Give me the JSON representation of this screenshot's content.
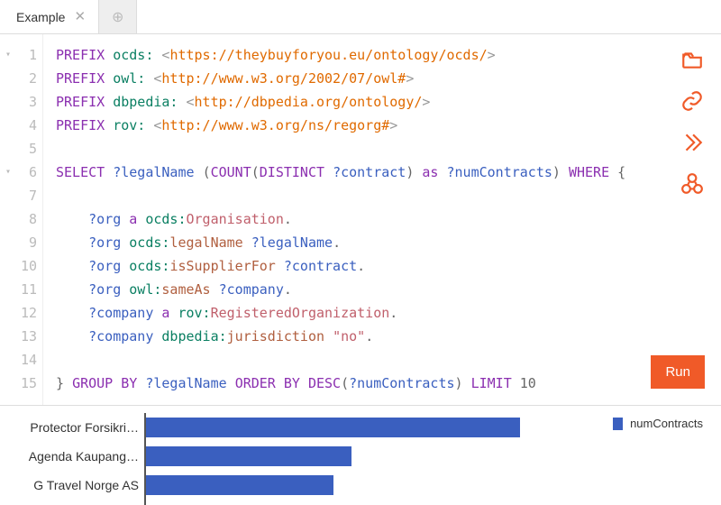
{
  "tabs": {
    "active_label": "Example"
  },
  "editor": {
    "lines": [
      [
        [
          "kw",
          "PREFIX"
        ],
        [
          "sp",
          " "
        ],
        [
          "pfx",
          "ocds:"
        ],
        [
          "sp",
          " "
        ],
        [
          "ang",
          "<"
        ],
        [
          "uri",
          "https://theybuyforyou.eu/ontology/ocds/"
        ],
        [
          "ang",
          ">"
        ]
      ],
      [
        [
          "kw",
          "PREFIX"
        ],
        [
          "sp",
          " "
        ],
        [
          "pfx",
          "owl:"
        ],
        [
          "sp",
          " "
        ],
        [
          "ang",
          "<"
        ],
        [
          "uri",
          "http://www.w3.org/2002/07/owl#"
        ],
        [
          "ang",
          ">"
        ]
      ],
      [
        [
          "kw",
          "PREFIX"
        ],
        [
          "sp",
          " "
        ],
        [
          "pfx",
          "dbpedia:"
        ],
        [
          "sp",
          " "
        ],
        [
          "ang",
          "<"
        ],
        [
          "uri",
          "http://dbpedia.org/ontology/"
        ],
        [
          "ang",
          ">"
        ]
      ],
      [
        [
          "kw",
          "PREFIX"
        ],
        [
          "sp",
          " "
        ],
        [
          "pfx",
          "rov:"
        ],
        [
          "sp",
          " "
        ],
        [
          "ang",
          "<"
        ],
        [
          "uri",
          "http://www.w3.org/ns/regorg#"
        ],
        [
          "ang",
          ">"
        ]
      ],
      [],
      [
        [
          "kw",
          "SELECT"
        ],
        [
          "sp",
          " "
        ],
        [
          "var",
          "?legalName"
        ],
        [
          "sp",
          " "
        ],
        [
          "punct",
          "("
        ],
        [
          "kw",
          "COUNT"
        ],
        [
          "punct",
          "("
        ],
        [
          "kw",
          "DISTINCT"
        ],
        [
          "sp",
          " "
        ],
        [
          "var",
          "?contract"
        ],
        [
          "punct",
          ")"
        ],
        [
          "sp",
          " "
        ],
        [
          "kw",
          "as"
        ],
        [
          "sp",
          " "
        ],
        [
          "var",
          "?numContracts"
        ],
        [
          "punct",
          ")"
        ],
        [
          "sp",
          " "
        ],
        [
          "kw",
          "WHERE"
        ],
        [
          "sp",
          " "
        ],
        [
          "punct",
          "{"
        ]
      ],
      [],
      [
        [
          "sp",
          "    "
        ],
        [
          "var",
          "?org"
        ],
        [
          "sp",
          " "
        ],
        [
          "kw",
          "a"
        ],
        [
          "sp",
          " "
        ],
        [
          "pfx",
          "ocds:"
        ],
        [
          "prop",
          "Organisation"
        ],
        [
          "punct",
          "."
        ]
      ],
      [
        [
          "sp",
          "    "
        ],
        [
          "var",
          "?org"
        ],
        [
          "sp",
          " "
        ],
        [
          "pfx",
          "ocds:"
        ],
        [
          "pred",
          "legalName"
        ],
        [
          "sp",
          " "
        ],
        [
          "var",
          "?legalName"
        ],
        [
          "punct",
          "."
        ]
      ],
      [
        [
          "sp",
          "    "
        ],
        [
          "var",
          "?org"
        ],
        [
          "sp",
          " "
        ],
        [
          "pfx",
          "ocds:"
        ],
        [
          "pred",
          "isSupplierFor"
        ],
        [
          "sp",
          " "
        ],
        [
          "var",
          "?contract"
        ],
        [
          "punct",
          "."
        ]
      ],
      [
        [
          "sp",
          "    "
        ],
        [
          "var",
          "?org"
        ],
        [
          "sp",
          " "
        ],
        [
          "pfx",
          "owl:"
        ],
        [
          "pred",
          "sameAs"
        ],
        [
          "sp",
          " "
        ],
        [
          "var",
          "?company"
        ],
        [
          "punct",
          "."
        ]
      ],
      [
        [
          "sp",
          "    "
        ],
        [
          "var",
          "?company"
        ],
        [
          "sp",
          " "
        ],
        [
          "kw",
          "a"
        ],
        [
          "sp",
          " "
        ],
        [
          "pfx",
          "rov:"
        ],
        [
          "prop",
          "RegisteredOrganization"
        ],
        [
          "punct",
          "."
        ]
      ],
      [
        [
          "sp",
          "    "
        ],
        [
          "var",
          "?company"
        ],
        [
          "sp",
          " "
        ],
        [
          "pfx",
          "dbpedia:"
        ],
        [
          "pred",
          "jurisdiction"
        ],
        [
          "sp",
          " "
        ],
        [
          "lit",
          "\"no\""
        ],
        [
          "punct",
          "."
        ]
      ],
      [],
      [
        [
          "punct",
          "}"
        ],
        [
          "sp",
          " "
        ],
        [
          "kw",
          "GROUP BY"
        ],
        [
          "sp",
          " "
        ],
        [
          "var",
          "?legalName"
        ],
        [
          "sp",
          " "
        ],
        [
          "kw",
          "ORDER BY"
        ],
        [
          "sp",
          " "
        ],
        [
          "kw",
          "DESC"
        ],
        [
          "punct",
          "("
        ],
        [
          "var",
          "?numContracts"
        ],
        [
          "punct",
          ")"
        ],
        [
          "sp",
          " "
        ],
        [
          "kw",
          "LIMIT"
        ],
        [
          "sp",
          " "
        ],
        [
          "punct",
          "10"
        ]
      ]
    ],
    "fold_markers": {
      "0": "▾",
      "5": "▾"
    },
    "line_count": 15
  },
  "toolbar": {
    "run_label": "Run"
  },
  "chart_data": {
    "type": "bar",
    "orientation": "horizontal",
    "series_name": "numContracts",
    "categories": [
      "Protector Forsikri…",
      "Agenda Kaupang…",
      "G Travel Norge AS"
    ],
    "values": [
      100,
      55,
      50
    ],
    "max": 120
  }
}
